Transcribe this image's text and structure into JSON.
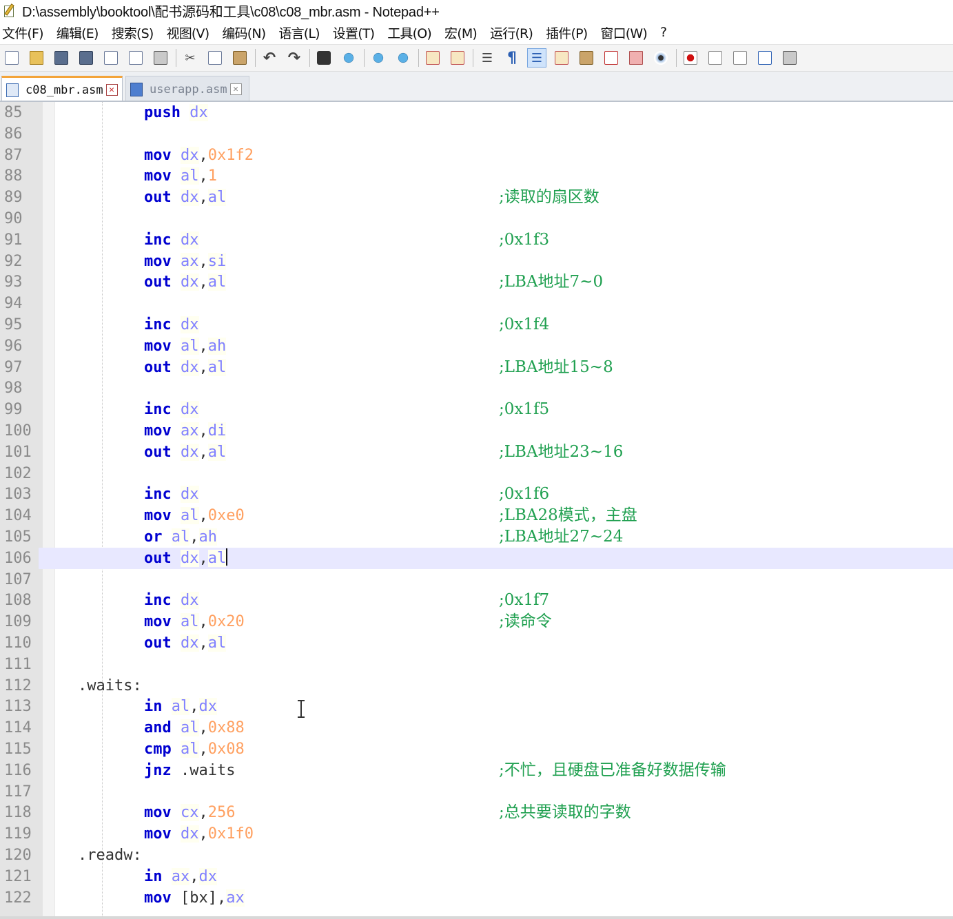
{
  "window": {
    "title": "D:\\assembly\\booktool\\配书源码和工具\\c08\\c08_mbr.asm - Notepad++"
  },
  "menu": [
    "文件(F)",
    "编辑(E)",
    "搜索(S)",
    "视图(V)",
    "编码(N)",
    "语言(L)",
    "设置(T)",
    "工具(O)",
    "宏(M)",
    "运行(R)",
    "插件(P)",
    "窗口(W)",
    "?"
  ],
  "toolbar": {
    "icons": [
      "new-file-icon",
      "open-file-icon",
      "save-icon",
      "save-all-icon",
      "close-icon",
      "close-all-icon",
      "print-icon",
      "cut-icon",
      "copy-icon",
      "paste-icon",
      "undo-icon",
      "redo-icon",
      "find-icon",
      "replace-icon",
      "zoom-in-icon",
      "zoom-out-icon",
      "sync-vertical-icon",
      "sync-horizontal-icon",
      "word-wrap-icon",
      "show-all-chars-icon",
      "indent-guide-icon",
      "user-lang-icon",
      "doc-map-icon",
      "function-list-icon",
      "folder-workspace-icon",
      "monitoring-icon",
      "macro-record-icon",
      "macro-stop-icon",
      "macro-play-icon",
      "macro-run-multiple-icon",
      "macro-save-icon"
    ]
  },
  "tabs": [
    {
      "label": "c08_mbr.asm",
      "active": true
    },
    {
      "label": "userapp.asm",
      "active": false
    }
  ],
  "editor": {
    "current_line": 106,
    "lines": [
      {
        "n": "85",
        "tokens": [
          [
            "instr",
            "push"
          ],
          [
            "sp",
            " "
          ],
          [
            "reg",
            "dx"
          ]
        ],
        "comment": ""
      },
      {
        "n": "86",
        "tokens": [],
        "comment": ""
      },
      {
        "n": "87",
        "tokens": [
          [
            "instr",
            "mov"
          ],
          [
            "sp",
            " "
          ],
          [
            "reg",
            "dx"
          ],
          [
            "punct",
            ","
          ],
          [
            "num",
            "0x1f2"
          ]
        ],
        "comment": ""
      },
      {
        "n": "88",
        "tokens": [
          [
            "instr",
            "mov"
          ],
          [
            "sp",
            " "
          ],
          [
            "reg",
            "al"
          ],
          [
            "punct",
            ","
          ],
          [
            "num",
            "1"
          ]
        ],
        "comment": ""
      },
      {
        "n": "89",
        "tokens": [
          [
            "instr",
            "out"
          ],
          [
            "sp",
            " "
          ],
          [
            "reg",
            "dx"
          ],
          [
            "punct",
            ","
          ],
          [
            "reg",
            "al"
          ]
        ],
        "comment": ";读取的扇区数"
      },
      {
        "n": "90",
        "tokens": [],
        "comment": ""
      },
      {
        "n": "91",
        "tokens": [
          [
            "instr",
            "inc"
          ],
          [
            "sp",
            " "
          ],
          [
            "reg",
            "dx"
          ]
        ],
        "comment": ";0x1f3"
      },
      {
        "n": "92",
        "tokens": [
          [
            "instr",
            "mov"
          ],
          [
            "sp",
            " "
          ],
          [
            "reg",
            "ax"
          ],
          [
            "punct",
            ","
          ],
          [
            "reg",
            "si"
          ]
        ],
        "comment": ""
      },
      {
        "n": "93",
        "tokens": [
          [
            "instr",
            "out"
          ],
          [
            "sp",
            " "
          ],
          [
            "reg",
            "dx"
          ],
          [
            "punct",
            ","
          ],
          [
            "reg",
            "al"
          ]
        ],
        "comment": ";LBA地址7~0"
      },
      {
        "n": "94",
        "tokens": [],
        "comment": ""
      },
      {
        "n": "95",
        "tokens": [
          [
            "instr",
            "inc"
          ],
          [
            "sp",
            " "
          ],
          [
            "reg",
            "dx"
          ]
        ],
        "comment": ";0x1f4"
      },
      {
        "n": "96",
        "tokens": [
          [
            "instr",
            "mov"
          ],
          [
            "sp",
            " "
          ],
          [
            "reg",
            "al"
          ],
          [
            "punct",
            ","
          ],
          [
            "reg",
            "ah"
          ]
        ],
        "comment": ""
      },
      {
        "n": "97",
        "tokens": [
          [
            "instr",
            "out"
          ],
          [
            "sp",
            " "
          ],
          [
            "reg",
            "dx"
          ],
          [
            "punct",
            ","
          ],
          [
            "reg",
            "al"
          ]
        ],
        "comment": ";LBA地址15~8"
      },
      {
        "n": "98",
        "tokens": [],
        "comment": ""
      },
      {
        "n": "99",
        "tokens": [
          [
            "instr",
            "inc"
          ],
          [
            "sp",
            " "
          ],
          [
            "reg",
            "dx"
          ]
        ],
        "comment": ";0x1f5"
      },
      {
        "n": "100",
        "tokens": [
          [
            "instr",
            "mov"
          ],
          [
            "sp",
            " "
          ],
          [
            "reg",
            "ax"
          ],
          [
            "punct",
            ","
          ],
          [
            "reg",
            "di"
          ]
        ],
        "comment": ""
      },
      {
        "n": "101",
        "tokens": [
          [
            "instr",
            "out"
          ],
          [
            "sp",
            " "
          ],
          [
            "reg",
            "dx"
          ],
          [
            "punct",
            ","
          ],
          [
            "reg",
            "al"
          ]
        ],
        "comment": ";LBA地址23~16"
      },
      {
        "n": "102",
        "tokens": [],
        "comment": ""
      },
      {
        "n": "103",
        "tokens": [
          [
            "instr",
            "inc"
          ],
          [
            "sp",
            " "
          ],
          [
            "reg",
            "dx"
          ]
        ],
        "comment": ";0x1f6"
      },
      {
        "n": "104",
        "tokens": [
          [
            "instr",
            "mov"
          ],
          [
            "sp",
            " "
          ],
          [
            "reg",
            "al"
          ],
          [
            "punct",
            ","
          ],
          [
            "num",
            "0xe0"
          ]
        ],
        "comment": ";LBA28模式，主盘"
      },
      {
        "n": "105",
        "tokens": [
          [
            "instr",
            "or"
          ],
          [
            "sp",
            " "
          ],
          [
            "reg",
            "al"
          ],
          [
            "punct",
            ","
          ],
          [
            "reg",
            "ah"
          ]
        ],
        "comment": ";LBA地址27~24"
      },
      {
        "n": "106",
        "tokens": [
          [
            "instr",
            "out"
          ],
          [
            "sp",
            " "
          ],
          [
            "reg",
            "dx"
          ],
          [
            "punct",
            ","
          ],
          [
            "reg",
            "al"
          ]
        ],
        "comment": ""
      },
      {
        "n": "107",
        "tokens": [],
        "comment": ""
      },
      {
        "n": "108",
        "tokens": [
          [
            "instr",
            "inc"
          ],
          [
            "sp",
            " "
          ],
          [
            "reg",
            "dx"
          ]
        ],
        "comment": ";0x1f7"
      },
      {
        "n": "109",
        "tokens": [
          [
            "instr",
            "mov"
          ],
          [
            "sp",
            " "
          ],
          [
            "reg",
            "al"
          ],
          [
            "punct",
            ","
          ],
          [
            "num",
            "0x20"
          ]
        ],
        "comment": ";读命令"
      },
      {
        "n": "110",
        "tokens": [
          [
            "instr",
            "out"
          ],
          [
            "sp",
            " "
          ],
          [
            "reg",
            "dx"
          ],
          [
            "punct",
            ","
          ],
          [
            "reg",
            "al"
          ]
        ],
        "comment": ""
      },
      {
        "n": "111",
        "tokens": [],
        "comment": ""
      },
      {
        "n": "112",
        "label": ".waits:",
        "tokens": [],
        "comment": ""
      },
      {
        "n": "113",
        "tokens": [
          [
            "instr",
            "in"
          ],
          [
            "sp",
            " "
          ],
          [
            "reg",
            "al"
          ],
          [
            "punct",
            ","
          ],
          [
            "reg",
            "dx"
          ]
        ],
        "comment": ""
      },
      {
        "n": "114",
        "tokens": [
          [
            "instr",
            "and"
          ],
          [
            "sp",
            " "
          ],
          [
            "reg",
            "al"
          ],
          [
            "punct",
            ","
          ],
          [
            "num",
            "0x88"
          ]
        ],
        "comment": ""
      },
      {
        "n": "115",
        "tokens": [
          [
            "instr",
            "cmp"
          ],
          [
            "sp",
            " "
          ],
          [
            "reg",
            "al"
          ],
          [
            "punct",
            ","
          ],
          [
            "num",
            "0x08"
          ]
        ],
        "comment": ""
      },
      {
        "n": "116",
        "tokens": [
          [
            "instr",
            "jnz"
          ],
          [
            "sp",
            " "
          ],
          [
            "lbl",
            ".waits"
          ]
        ],
        "comment": ";不忙，且硬盘已准备好数据传输"
      },
      {
        "n": "117",
        "tokens": [],
        "comment": ""
      },
      {
        "n": "118",
        "tokens": [
          [
            "instr",
            "mov"
          ],
          [
            "sp",
            " "
          ],
          [
            "reg",
            "cx"
          ],
          [
            "punct",
            ","
          ],
          [
            "num",
            "256"
          ]
        ],
        "comment": ";总共要读取的字数"
      },
      {
        "n": "119",
        "tokens": [
          [
            "instr",
            "mov"
          ],
          [
            "sp",
            " "
          ],
          [
            "reg",
            "dx"
          ],
          [
            "punct",
            ","
          ],
          [
            "num",
            "0x1f0"
          ]
        ],
        "comment": ""
      },
      {
        "n": "120",
        "label": ".readw:",
        "tokens": [],
        "comment": ""
      },
      {
        "n": "121",
        "tokens": [
          [
            "instr",
            "in"
          ],
          [
            "sp",
            " "
          ],
          [
            "reg",
            "ax"
          ],
          [
            "punct",
            ","
          ],
          [
            "reg",
            "dx"
          ]
        ],
        "comment": ""
      },
      {
        "n": "122",
        "tokens": [
          [
            "instr",
            "mov"
          ],
          [
            "sp",
            " "
          ],
          [
            "punct",
            "[bx]"
          ],
          [
            "punct",
            ","
          ],
          [
            "reg",
            "ax"
          ]
        ],
        "comment": ""
      }
    ]
  }
}
